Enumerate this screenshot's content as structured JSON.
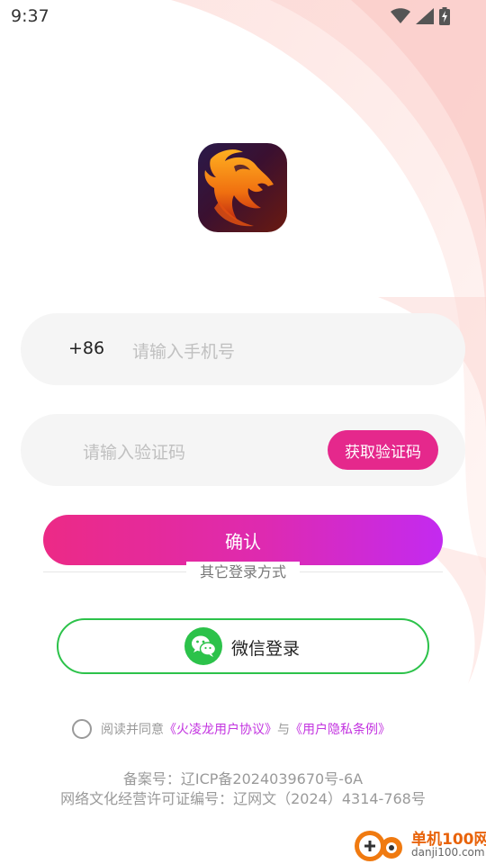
{
  "status_bar": {
    "time": "9:37",
    "icons": [
      "wifi-icon",
      "cell-signal-icon",
      "battery-charging-icon"
    ]
  },
  "app": {
    "logo_icon": "dragon-logo-icon"
  },
  "phone_field": {
    "country_code": "+86",
    "placeholder": "请输入手机号"
  },
  "code_field": {
    "placeholder": "请输入验证码",
    "get_code_label": "获取验证码"
  },
  "confirm_label": "确认",
  "other_login_label": "其它登录方式",
  "wechat": {
    "icon": "wechat-icon",
    "label": "微信登录"
  },
  "agreement": {
    "prefix": "阅读并同意",
    "user_agreement": "《火凌龙用户协议》",
    "conjunction": "与",
    "privacy_policy": "《用户隐私条例》",
    "checked": false
  },
  "footer": {
    "record_number": "备案号：辽ICP备2024039670号-6A",
    "license_number": "网络文化经营许可证编号：辽网文（2024）4314-768号"
  },
  "watermark": {
    "main": "单机100网",
    "sub": "danji100.com"
  },
  "colors": {
    "accent_pink": "#e5288c",
    "gradient_end_purple": "#c32af0",
    "wechat_green": "#2cc24a",
    "link_purple": "#c334e0"
  }
}
